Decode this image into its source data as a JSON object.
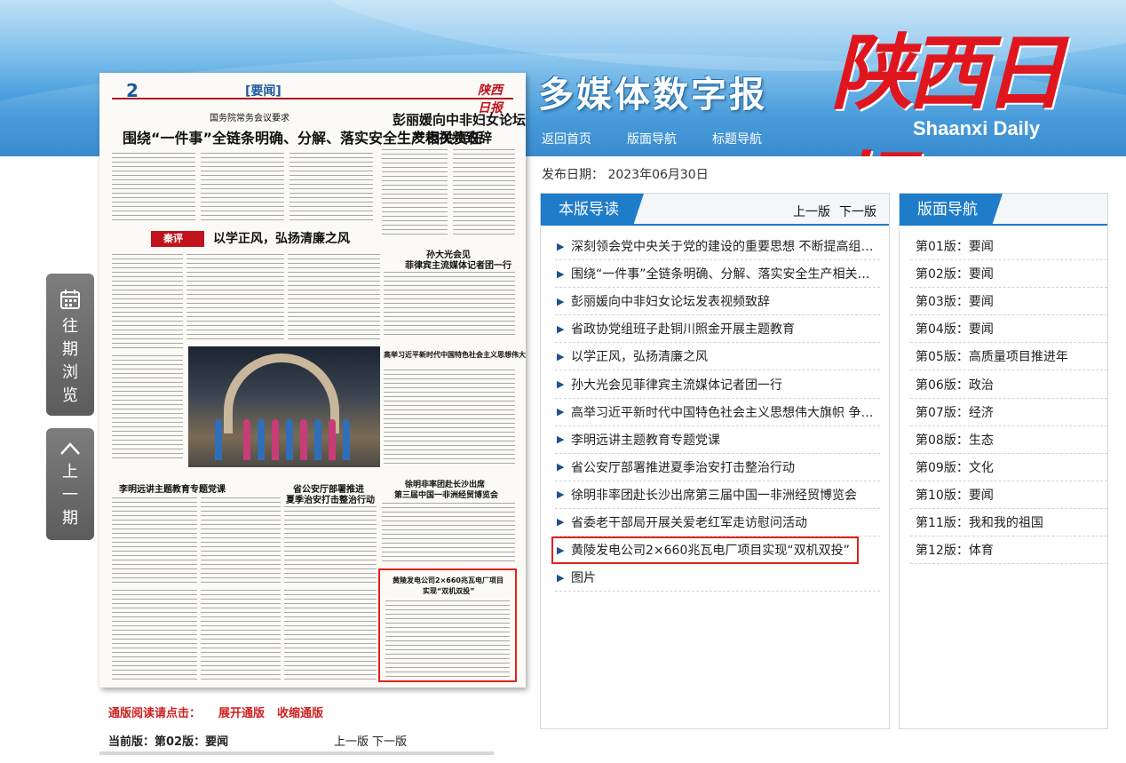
{
  "header": {
    "slogan": "多媒体数字报",
    "logo_cn": "陕西日报",
    "logo_en": "Shaanxi Daily",
    "nav": [
      "返回首页",
      "版面导航",
      "标题导航"
    ]
  },
  "paper": {
    "page_num": "2",
    "section": "[要闻]",
    "logo": "陕西日报",
    "headlines": {
      "h1_kicker": "国务院常务会议要求",
      "h1": "围绕“一件事”全链条明确、分解、落实安全生产相关责任",
      "h2": "彭丽媛向中非妇女论坛",
      "h2b": "发表视频致辞",
      "comment_seal": "秦评",
      "comment": "以学正风，弘扬清廉之风",
      "h3": "孙大光会见",
      "h3b": "菲律宾主流媒体记者团一行",
      "h4": "高举习近平新时代中国特色社会主义思想伟大旗帜",
      "h5": "李明远讲主题教育专题党课",
      "h6": "省公安厅部署推进",
      "h6b": "夏季治安打击整治行动",
      "h7": "徐明非率团赴长沙出席",
      "h7b": "第三届中国一非洲经贸博览会",
      "h8": "黄陵发电公司2×660兆瓦电厂项目",
      "h8b": "实现“双机双投”"
    }
  },
  "below_paper": {
    "read_prompt": "通版阅读请点击：",
    "expand": "展开通版",
    "collapse": "收缩通版",
    "current_page": "当前版：第02版：要闻",
    "prev": "上一版",
    "next": "下一版"
  },
  "side": {
    "archive": "往期浏览",
    "prev_issue": "上一期"
  },
  "date": {
    "label": "发布日期：",
    "value": "2023年06月30日"
  },
  "articles_panel": {
    "title": "本版导读",
    "prev": "上一版",
    "next": "下一版",
    "items": [
      "深刻领会党中央关于党的建设的重要思想 不断提高组织建设质量",
      "围绕“一件事”全链条明确、分解、落实安全生产相关责任",
      "彭丽媛向中非妇女论坛发表视频致辞",
      "省政协党组班子赴铜川照金开展主题教育",
      "以学正风，弘扬清廉之风",
      "孙大光会见菲律宾主流媒体记者团一行",
      "高举习近平新时代中国特色社会主义思想伟大旗帜 争做新时代好青年",
      "李明远讲主题教育专题党课",
      "省公安厅部署推进夏季治安打击整治行动",
      "徐明非率团赴长沙出席第三届中国一非洲经贸博览会",
      "省委老干部局开展关爱老红军走访慰问活动",
      "黄陵发电公司2×660兆瓦电厂项目实现“双机双投”",
      "图片"
    ],
    "highlight_index": 11
  },
  "editions_panel": {
    "title": "版面导航",
    "items": [
      "第01版：要闻",
      "第02版：要闻",
      "第03版：要闻",
      "第04版：要闻",
      "第05版：高质量项目推进年",
      "第06版：政治",
      "第07版：经济",
      "第08版：生态",
      "第09版：文化",
      "第10版：要闻",
      "第11版：我和我的祖国",
      "第12版：体育"
    ]
  },
  "colors": {
    "brand_blue": "#1f7cc8",
    "brand_red": "#e0161e",
    "highlight": "#e0231f"
  }
}
